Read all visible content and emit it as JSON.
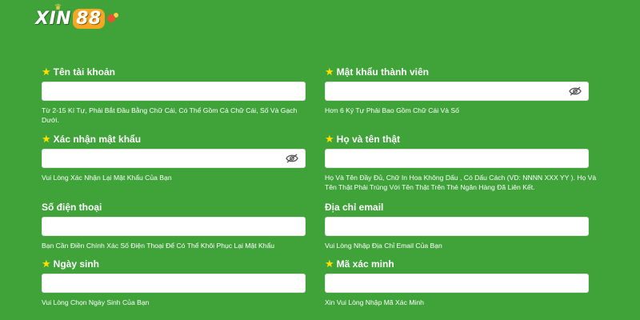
{
  "brand": {
    "logo_text": "XIN",
    "logo_number": "88"
  },
  "form": {
    "username": {
      "label": "Tên tài khoản",
      "value": "",
      "hint": "Từ 2-15 Kí Tự, Phải Bắt Đầu Bằng Chữ Cái, Có Thể Gồm Cả Chữ Cái, Số Và Gạch Dưới.",
      "required_icon": "star-icon"
    },
    "password": {
      "label": "Mật khẩu thành viên",
      "value": "",
      "hint": "Hơn 6 Ký Tự Phải Bao Gồm Chữ Cái Và Số",
      "toggle_icon": "eye-slash-icon",
      "required_icon": "star-icon"
    },
    "confirm_password": {
      "label": "Xác nhận mật khẩu",
      "value": "",
      "hint": "Vui Lòng Xác Nhận Lại Mật Khẩu Của Bạn",
      "toggle_icon": "eye-slash-icon",
      "required_icon": "star-icon"
    },
    "full_name": {
      "label": "Họ và tên thật",
      "value": "",
      "hint": "Họ Và Tên Đầy Đủ, Chữ In Hoa Không Dấu , Có Dấu Cách (VD: NNNN XXX YY ). Họ Và Tên Thật Phải Trùng Với Tên Thật Trên Thẻ Ngân Hàng Đã Liên Kết.",
      "required_icon": "star-icon"
    },
    "phone": {
      "label": "Số điện thoại",
      "value": "",
      "hint": "Bạn Cần Điền Chính Xác Số Điện Thoại Để Có Thể Khôi Phục Lại Mật Khẩu"
    },
    "email": {
      "label": "Địa chỉ email",
      "value": "",
      "hint": "Vui Lòng Nhập Địa Chỉ Email Của Bạn"
    },
    "birthday": {
      "label": "Ngày sinh",
      "value": "",
      "hint": "Vui Lòng Chọn Ngày Sinh Của Bạn",
      "required_icon": "star-icon"
    },
    "captcha": {
      "label": "Mã xác minh",
      "value": "",
      "hint": "Xin Vui Lòng Nhập Mã Xác Minh",
      "required_icon": "star-icon"
    }
  },
  "colors": {
    "background": "#3fa33a",
    "required_star": "#ffe000",
    "input_bg": "#ffffff"
  }
}
